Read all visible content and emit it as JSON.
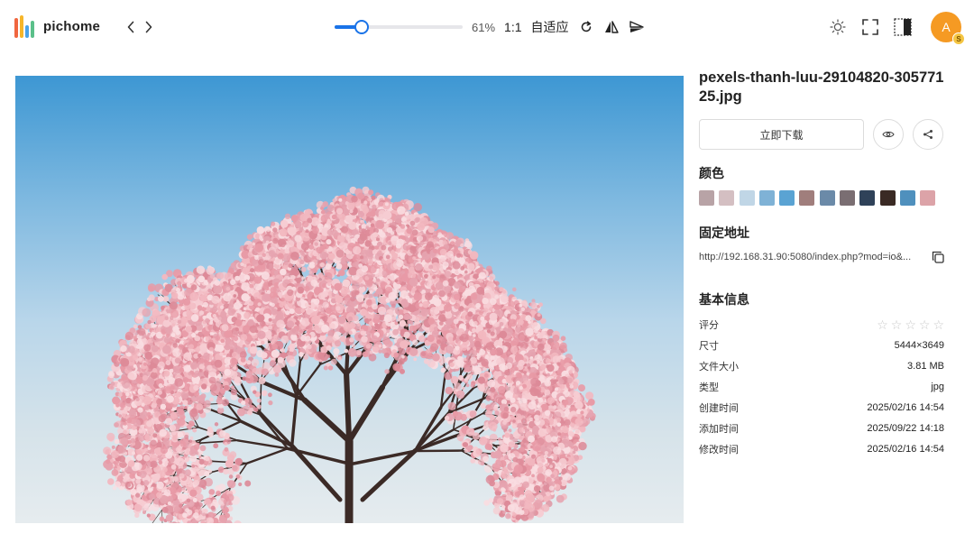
{
  "app": {
    "name": "pichome",
    "brand_colors": [
      "#f0663f",
      "#f6b62a",
      "#4aa3ea",
      "#5bc08a"
    ]
  },
  "toolbar": {
    "prev_icon": "chevron-left-icon",
    "next_icon": "chevron-right-icon",
    "zoom_value": 61,
    "zoom_label": "61%",
    "actual_size_label": "1:1",
    "fit_label": "自适应",
    "rotate_icon": "rotate-icon",
    "flip_icon": "flip-horizontal-icon",
    "flip_vertical_icon": "flip-vertical-icon",
    "theme_icon": "sun-icon",
    "fullscreen_icon": "fullscreen-icon",
    "panel_toggle_icon": "panel-toggle-icon",
    "avatar_letter": "A",
    "avatar_badge": "S",
    "accent": "#1a73e8",
    "avatar_color": "#f59a23"
  },
  "panel": {
    "file_name": "pexels-thanh-luu-29104820-30577125.jpg",
    "download_label": "立即下载",
    "preview_icon": "eye-icon",
    "share_icon": "share-icon",
    "colors_title": "颜色",
    "colors": [
      "#b8a3a6",
      "#d4bfc2",
      "#c0d6e6",
      "#7fb2d6",
      "#5aa3d3",
      "#a07e7c",
      "#6b8aa8",
      "#7a6e72",
      "#2f4259",
      "#3a2a24",
      "#4f90bd",
      "#dca3a8"
    ],
    "permalink_title": "固定地址",
    "permalink": "http://192.168.31.90:5080/index.php?mod=io&...",
    "copy_icon": "copy-icon",
    "basic_info_title": "基本信息",
    "rating_label": "评分",
    "rating_value": 0,
    "rating_max": 5,
    "info": [
      {
        "key": "尺寸",
        "value": "5444×3649"
      },
      {
        "key": "文件大小",
        "value": "3.81 MB"
      },
      {
        "key": "类型",
        "value": "jpg"
      },
      {
        "key": "创建时间",
        "value": "2025/02/16 14:54"
      },
      {
        "key": "添加时间",
        "value": "2025/09/22 14:18"
      },
      {
        "key": "修改时间",
        "value": "2025/02/16 14:54"
      }
    ]
  }
}
